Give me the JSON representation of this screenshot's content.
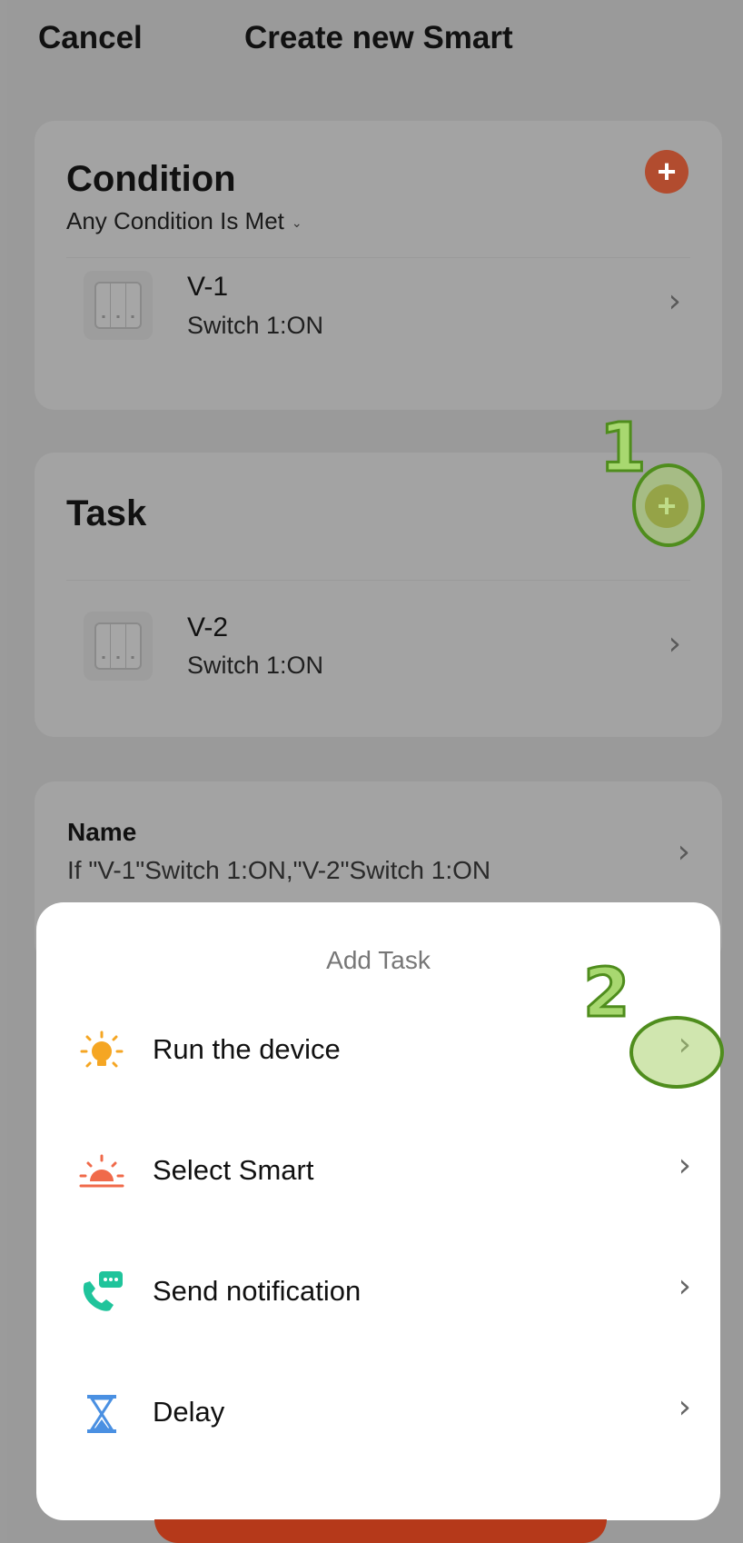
{
  "header": {
    "cancel_label": "Cancel",
    "title": "Create new Smart"
  },
  "condition": {
    "title": "Condition",
    "mode": "Any Condition Is Met",
    "add_symbol": "+",
    "device": {
      "name": "V-1",
      "state": "Switch 1:ON"
    }
  },
  "task": {
    "title": "Task",
    "add_symbol": "+",
    "device": {
      "name": "V-2",
      "state": "Switch 1:ON"
    }
  },
  "name_section": {
    "label": "Name",
    "value": "If \"V-1\"Switch 1:ON,\"V-2\"Switch 1:ON"
  },
  "annotations": {
    "step1": "1",
    "step2": "2"
  },
  "sheet": {
    "title": "Add Task",
    "items": [
      {
        "label": "Run the device",
        "icon": "bulb-icon",
        "icon_color": "#f5a623"
      },
      {
        "label": "Select Smart",
        "icon": "sunrise-icon",
        "icon_color": "#f06a4a"
      },
      {
        "label": "Send notification",
        "icon": "phone-message-icon",
        "icon_color": "#1fc49b"
      },
      {
        "label": "Delay",
        "icon": "hourglass-icon",
        "icon_color": "#4a90e2"
      }
    ]
  },
  "colors": {
    "overlay": "#9a9a9a",
    "add_condition": "#b24c2f",
    "annotation_green": "#4f8d1d",
    "primary_bar": "#b5391a"
  }
}
